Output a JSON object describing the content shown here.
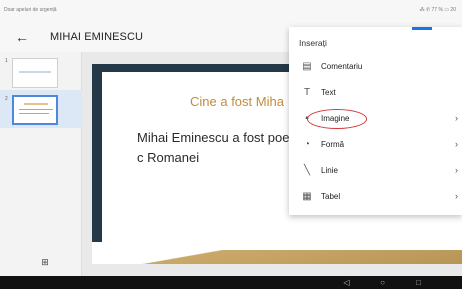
{
  "status": {
    "left": "Doar apeluri de urgență",
    "right": "⁂ ✆ 77 % ▭ 20"
  },
  "app_bar": {
    "back_icon": "arrow-left-icon",
    "title": "MIHAI EMINESCU"
  },
  "sidebar": {
    "slides": [
      {
        "number": "1",
        "selected": false
      },
      {
        "number": "2",
        "selected": true
      }
    ],
    "add_icon": "add-slide-icon"
  },
  "slide": {
    "title": "Cine a fost Miha",
    "body": "Mihai Eminescu a fost poe jurnalist, fiind considerat c Romanei"
  },
  "menu": {
    "title": "Inserați",
    "items": [
      {
        "label": "Comentariu",
        "icon": "comment-icon",
        "has_submenu": false
      },
      {
        "label": "Text",
        "icon": "text-box-icon",
        "has_submenu": false
      },
      {
        "label": "Imagine",
        "icon": "image-icon",
        "has_submenu": true
      },
      {
        "label": "Formă",
        "icon": "shape-icon",
        "has_submenu": true
      },
      {
        "label": "Linie",
        "icon": "line-icon",
        "has_submenu": true
      },
      {
        "label": "Tabel",
        "icon": "table-icon",
        "has_submenu": true
      }
    ]
  },
  "colors": {
    "accent": "#1a73e8",
    "slide_dark": "#243847",
    "slide_gold": "#c08c3c",
    "annotation_red": "#d23a3a"
  }
}
